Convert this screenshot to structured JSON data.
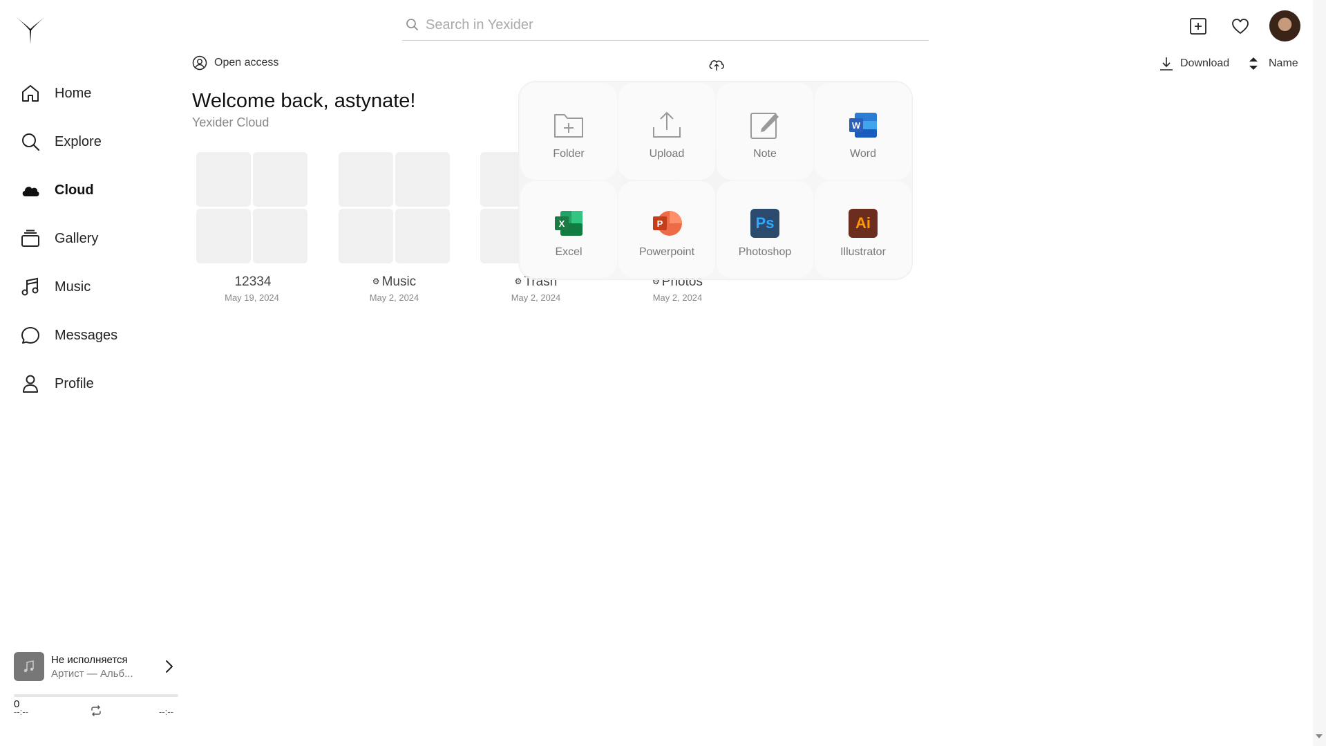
{
  "app": {
    "name": "Yexider"
  },
  "sidebar": {
    "items": [
      {
        "label": "Home",
        "icon": "home-icon"
      },
      {
        "label": "Explore",
        "icon": "search-icon"
      },
      {
        "label": "Cloud",
        "icon": "cloud-icon",
        "active": true
      },
      {
        "label": "Gallery",
        "icon": "gallery-icon"
      },
      {
        "label": "Music",
        "icon": "music-icon"
      },
      {
        "label": "Messages",
        "icon": "message-icon"
      },
      {
        "label": "Profile",
        "icon": "user-icon"
      }
    ]
  },
  "player": {
    "title": "Не исполняется",
    "subtitle": "Артист — Альб...",
    "position_value": "0",
    "time_current": "--:--",
    "time_total": "--:--"
  },
  "header": {
    "search_placeholder": "Search in Yexider"
  },
  "toolbar": {
    "access_label": "Open access",
    "download_label": "Download",
    "sort_label": "Name"
  },
  "main": {
    "welcome": "Welcome back, astynate!",
    "subtitle": "Yexider Cloud",
    "folders": [
      {
        "name": "12334",
        "date": "May 19, 2024",
        "gear": ""
      },
      {
        "name": "Music",
        "date": "May 2, 2024",
        "gear": "⚙"
      },
      {
        "name": "Trasn",
        "date": "May 2, 2024",
        "gear": "⚙"
      },
      {
        "name": "Photos",
        "date": "May 2, 2024",
        "gear": "⚙"
      }
    ]
  },
  "create_menu": {
    "items": [
      {
        "label": "Folder"
      },
      {
        "label": "Upload"
      },
      {
        "label": "Note"
      },
      {
        "label": "Word",
        "badge": "W",
        "color": "#2b5fb8"
      },
      {
        "label": "Excel",
        "badge": "X",
        "color": "#1d7a45"
      },
      {
        "label": "Powerpoint",
        "badge": "P",
        "color": "#d4553a"
      },
      {
        "label": "Photoshop",
        "badge": "Ps",
        "color": "#2c4a6e"
      },
      {
        "label": "Illustrator",
        "badge": "Ai",
        "color": "#6b2d1e"
      }
    ]
  }
}
